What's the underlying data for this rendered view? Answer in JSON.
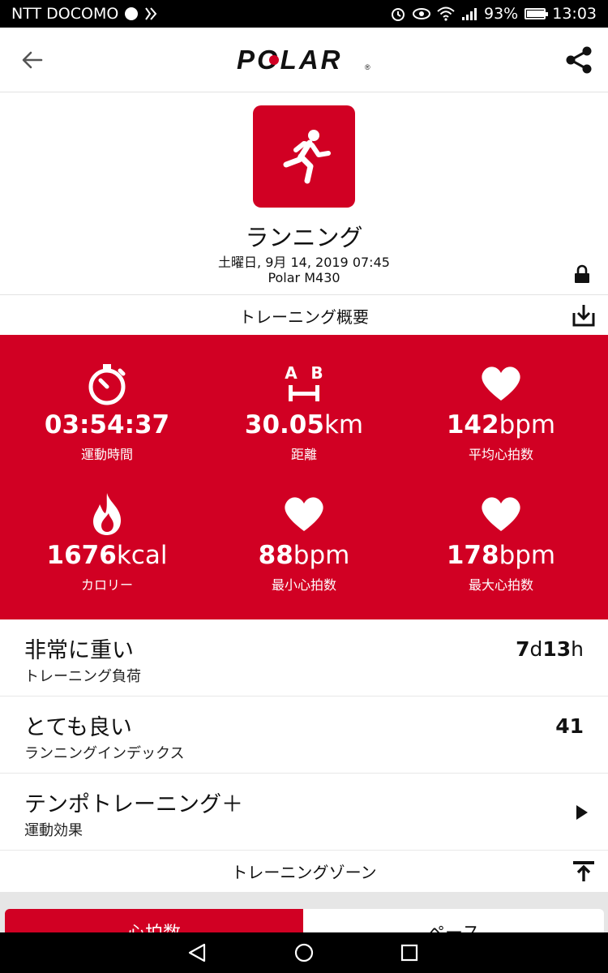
{
  "status_bar": {
    "carrier": "NTT DOCOMO",
    "battery": "93%",
    "battery_level": 0.93,
    "time": "13:03"
  },
  "header": {
    "logo_text": "POLAR",
    "logo_mark": "®",
    "icons": {
      "back": "back-arrow-icon",
      "share": "share-icon"
    }
  },
  "session": {
    "sport": "ランニング",
    "datetime": "土曜日, 9月 14, 2019 07:45",
    "device": "Polar M430"
  },
  "summary_bar": {
    "label": "トレーニング概要",
    "icon": "download-icon"
  },
  "stats": [
    {
      "icon": "stopwatch-icon",
      "value": "03:54:37",
      "unit": "",
      "label": "運動時間"
    },
    {
      "icon": "distance-icon",
      "value": "30.05",
      "unit": "km",
      "label": "距離",
      "icon_text_a": "A",
      "icon_text_b": "B"
    },
    {
      "icon": "heart-icon",
      "value": "142",
      "unit": "bpm",
      "label": "平均心拍数"
    },
    {
      "icon": "flame-icon",
      "value": "1676",
      "unit": "kcal",
      "label": "カロリー"
    },
    {
      "icon": "heart-icon",
      "value": "88",
      "unit": "bpm",
      "label": "最小心拍数"
    },
    {
      "icon": "heart-icon",
      "value": "178",
      "unit": "bpm",
      "label": "最大心拍数"
    }
  ],
  "rows": [
    {
      "title": "非常に重い",
      "subtitle": "トレーニング負荷",
      "value_a": "7",
      "unit_a": "d",
      "value_b": "13",
      "unit_b": "h"
    },
    {
      "title": "とても良い",
      "subtitle": "ランニングインデックス",
      "value": "41"
    },
    {
      "title": "テンポトレーニング＋",
      "subtitle": "運動効果",
      "icon": "play-arrow-icon"
    }
  ],
  "zones_bar": {
    "label": "トレーニングゾーン",
    "icon": "upload-icon"
  },
  "zone_tabs": [
    {
      "label": "心拍数",
      "active": true
    },
    {
      "label": "ペース",
      "active": false
    }
  ],
  "colors": {
    "accent": "#d10023",
    "text": "#111111",
    "background": "#ffffff"
  }
}
